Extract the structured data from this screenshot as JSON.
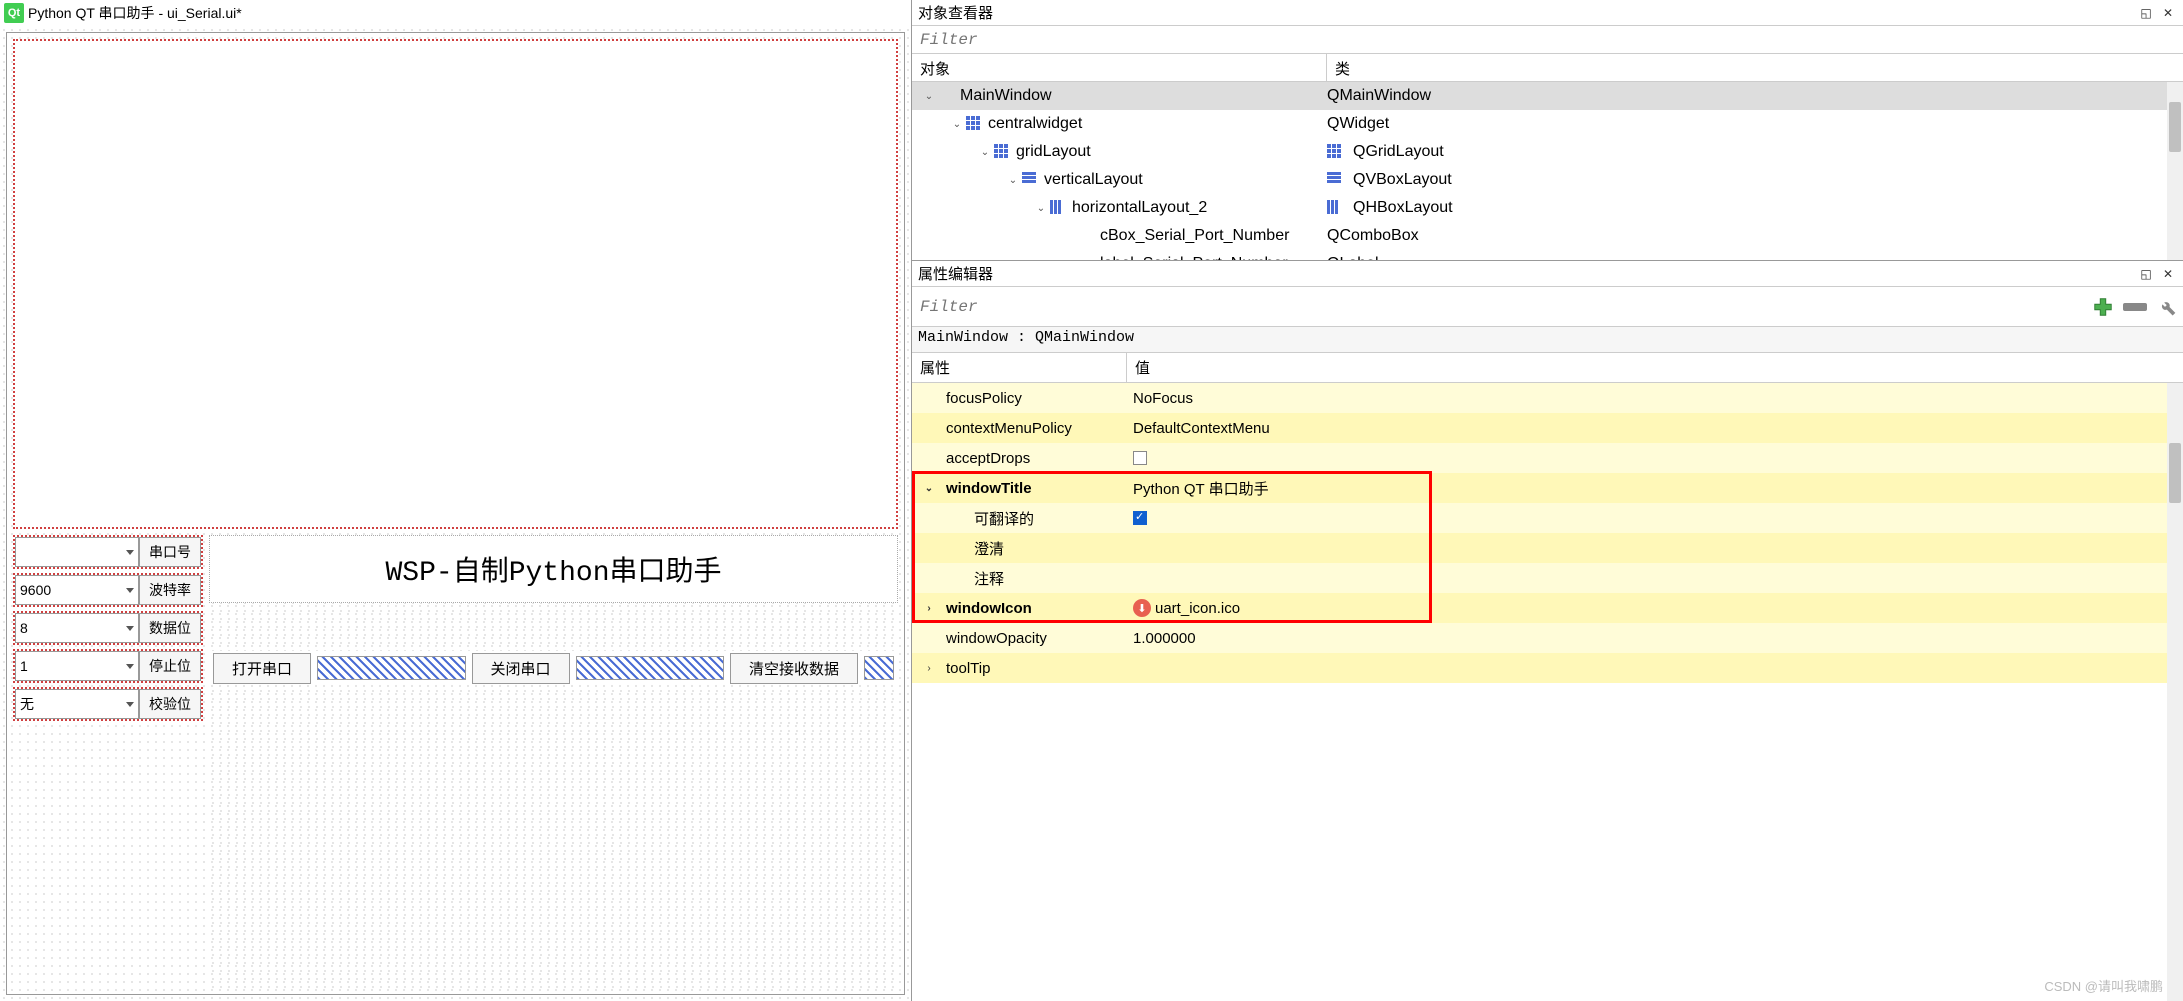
{
  "designer": {
    "window_title": "Python QT 串口助手 - ui_Serial.ui*",
    "center_label": "WSP-自制Python串口助手",
    "controls": {
      "port": {
        "value": "",
        "label": "串口号"
      },
      "baud": {
        "value": "9600",
        "label": "波特率"
      },
      "databits": {
        "value": "8",
        "label": "数据位"
      },
      "stopbits": {
        "value": "1",
        "label": "停止位"
      },
      "parity": {
        "value": "无",
        "label": "校验位"
      }
    },
    "buttons": {
      "open": "打开串口",
      "close": "关闭串口",
      "clear": "清空接收数据"
    }
  },
  "object_inspector": {
    "title": "对象查看器",
    "filter_placeholder": "Filter",
    "headers": {
      "object": "对象",
      "class": "类"
    },
    "rows": [
      {
        "indent": 0,
        "exp": "v",
        "name": "MainWindow",
        "cls": "QMainWindow",
        "sel": true,
        "icon": "none"
      },
      {
        "indent": 1,
        "exp": "v",
        "name": "centralwidget",
        "cls": "QWidget",
        "icon": "grid"
      },
      {
        "indent": 2,
        "exp": "v",
        "name": "gridLayout",
        "cls": "QGridLayout",
        "icon": "grid",
        "cls_icon": "grid"
      },
      {
        "indent": 3,
        "exp": "v",
        "name": "verticalLayout",
        "cls": "QVBoxLayout",
        "icon": "vbox",
        "cls_icon": "vbox"
      },
      {
        "indent": 4,
        "exp": "v",
        "name": "horizontalLayout_2",
        "cls": "QHBoxLayout",
        "icon": "hbox",
        "cls_icon": "hbox"
      },
      {
        "indent": 5,
        "exp": "",
        "name": "cBox_Serial_Port_Number",
        "cls": "QComboBox",
        "icon": "none"
      },
      {
        "indent": 5,
        "exp": "",
        "name": "label_Serial_Port_Number",
        "cls": "QLabel",
        "icon": "none"
      }
    ]
  },
  "property_editor": {
    "title": "属性编辑器",
    "filter_placeholder": "Filter",
    "context": "MainWindow : QMainWindow",
    "headers": {
      "prop": "属性",
      "val": "值"
    },
    "props": [
      {
        "name": "focusPolicy",
        "val": "NoFocus",
        "alt": false
      },
      {
        "name": "contextMenuPolicy",
        "val": "DefaultContextMenu",
        "alt": true
      },
      {
        "name": "acceptDrops",
        "val": "",
        "checkbox": false,
        "alt": false
      },
      {
        "name": "windowTitle",
        "val": "Python QT 串口助手",
        "bold": true,
        "exp": "v",
        "alt": true
      },
      {
        "name": "可翻译的",
        "val": "",
        "checkbox": true,
        "checked": true,
        "indent": 1,
        "alt": false
      },
      {
        "name": "澄清",
        "val": "",
        "indent": 1,
        "alt": true
      },
      {
        "name": "注释",
        "val": "",
        "indent": 1,
        "alt": false
      },
      {
        "name": "windowIcon",
        "val": "uart_icon.ico",
        "bold": true,
        "exp": ">",
        "icon": true,
        "alt": true
      },
      {
        "name": "windowOpacity",
        "val": "1.000000",
        "alt": false
      },
      {
        "name": "toolTip",
        "val": "",
        "exp": ">",
        "alt": true
      }
    ]
  },
  "watermark": "CSDN @请叫我啸鹏"
}
